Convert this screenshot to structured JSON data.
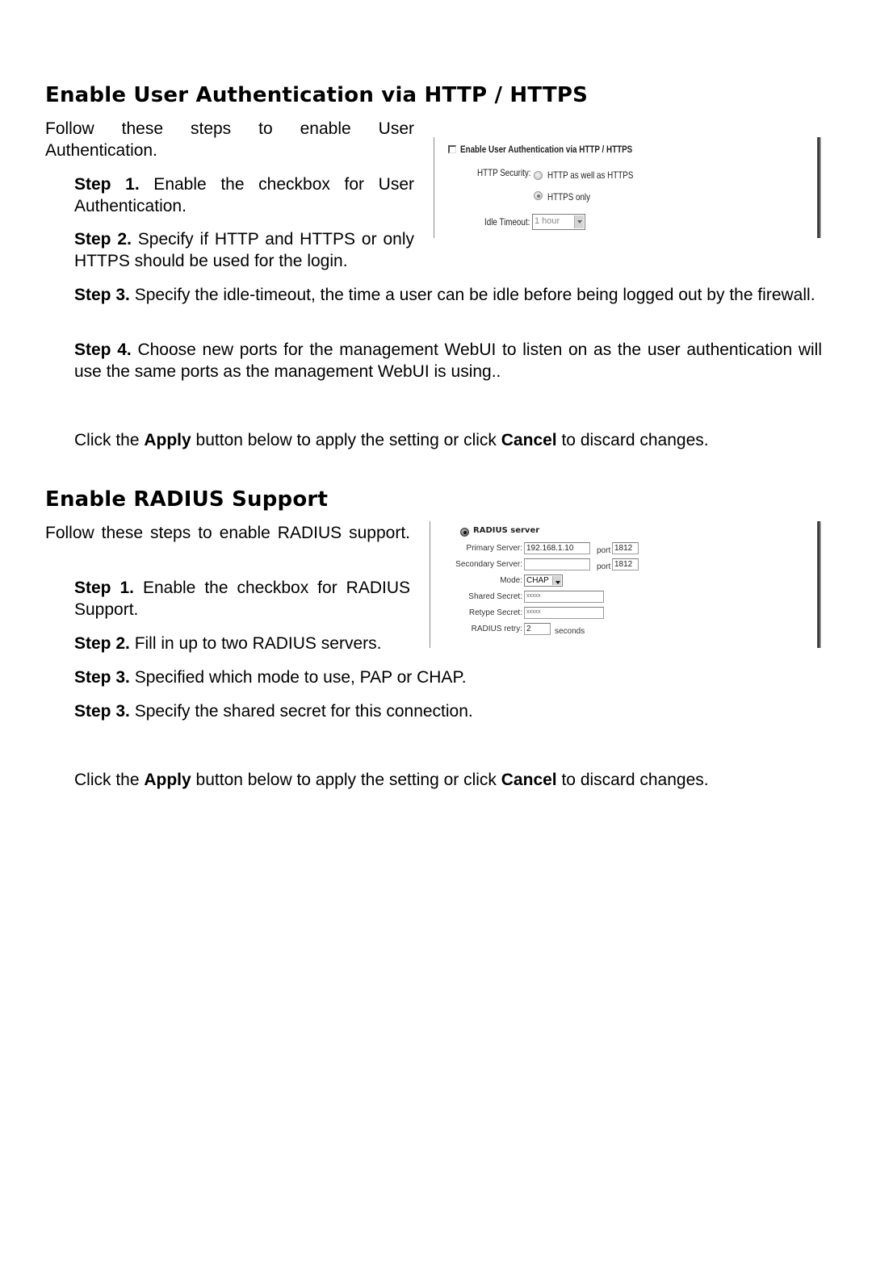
{
  "sections": [
    {
      "title": "Enable User Authentication via HTTP / HTTPS",
      "intro": "Follow these steps to enable User Authentication.",
      "steps": [
        {
          "label": "Step 1.",
          "text": " Enable the checkbox for User Authentication."
        },
        {
          "label": "Step 2.",
          "text": " Specify if HTTP and HTTPS or only HTTPS should be used for the login."
        },
        {
          "label": "Step 3.",
          "text": " Specify the idle-timeout, the time a user can be idle before being logged out by the firewall."
        },
        {
          "label": "Step 4.",
          "text": " Choose new ports for the management WebUI to listen on as the user authentication will use the same ports as the management WebUI is using.."
        }
      ],
      "footer": {
        "pre": "Click the ",
        "apply": "Apply",
        "mid": " button below to apply the setting or click ",
        "cancel": "Cancel",
        "post": " to discard changes."
      },
      "screenshot": {
        "checkbox_label": "Enable User Authentication via HTTP / HTTPS",
        "checkbox_checked": false,
        "http_security_label": "HTTP Security:",
        "radio_options": [
          {
            "label": "HTTP as well as HTTPS",
            "checked": false
          },
          {
            "label": "HTTPS only",
            "checked": true
          }
        ],
        "idle_timeout_label": "Idle Timeout:",
        "idle_timeout_value": "1 hour"
      }
    },
    {
      "title": "Enable RADIUS Support",
      "intro": "Follow these steps to enable RADIUS support.",
      "steps": [
        {
          "label": "Step 1.",
          "text": " Enable the checkbox for RADIUS Support."
        },
        {
          "label": "Step 2.",
          "text": " Fill in up to two RADIUS servers."
        },
        {
          "label": "Step 3.",
          "text": " Specified which mode to use, PAP or CHAP."
        },
        {
          "label": "Step 3.",
          "text": " Specify the shared secret for this connection."
        }
      ],
      "footer": {
        "pre": "Click the ",
        "apply": "Apply",
        "mid": " button below to apply the setting or click ",
        "cancel": "Cancel",
        "post": " to discard changes."
      },
      "screenshot": {
        "radio_label": "RADIUS server",
        "radio_checked": true,
        "primary_server_label": "Primary Server:",
        "primary_server_value": "192.168.1.10",
        "primary_port_label": "port",
        "primary_port_value": "1812",
        "secondary_server_label": "Secondary Server:",
        "secondary_server_value": "",
        "secondary_port_label": "port",
        "secondary_port_value": "1812",
        "mode_label": "Mode:",
        "mode_value": "CHAP",
        "shared_secret_label": "Shared Secret:",
        "shared_secret_value": "xxxxx",
        "retype_secret_label": "Retype Secret:",
        "retype_secret_value": "xxxxx",
        "retry_label": "RADIUS retry:",
        "retry_value": "2",
        "retry_unit": "seconds"
      }
    }
  ]
}
